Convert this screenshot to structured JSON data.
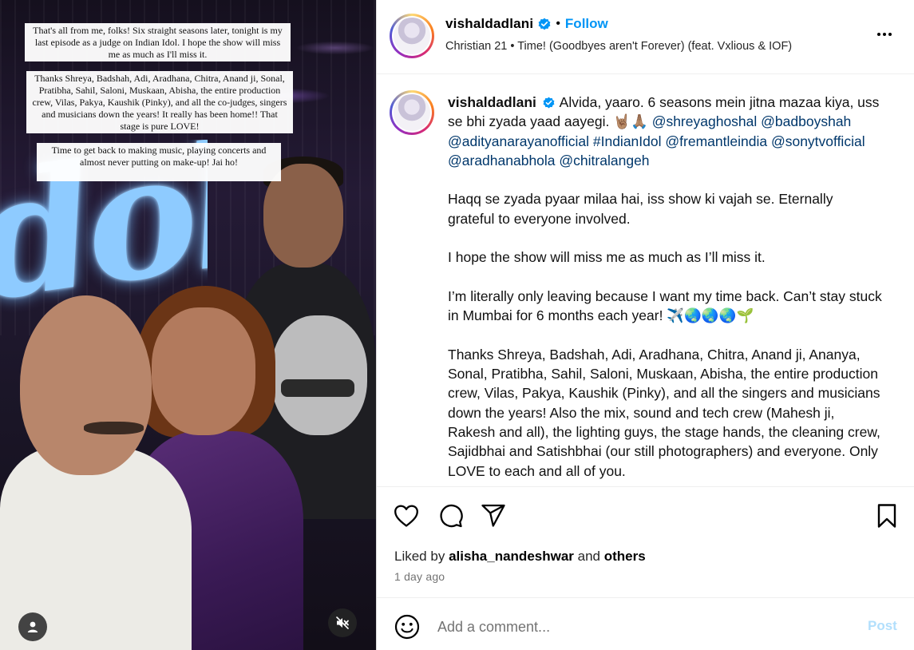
{
  "media": {
    "story_lines": [
      "That's all from me, folks! Six straight seasons later, tonight is my last episode as a judge on Indian Idol. I hope the show will miss me as much as I'll miss it.",
      "Thanks Shreya, Badshah, Adi, Aradhana, Chitra, Anand ji, Sonal, Pratibha, Sahil, Saloni, Muskaan, Abisha, the entire production crew, Vilas, Pakya, Kaushik (Pinky), and all the co-judges, singers and musicians down the years! It really has been home!! That stage is pure LOVE!",
      "Time to get back to making music, playing concerts and almost never putting on make-up! Jai ho!"
    ]
  },
  "header": {
    "username": "vishaldadlani",
    "separator": "•",
    "follow_label": "Follow",
    "song": "Christian 21 • Time! (Goodbyes aren't Forever) (feat. Vxlious & IOF)"
  },
  "caption": {
    "username": "vishaldadlani",
    "intro": "Alvida, yaaro. 6 seasons mein jitna mazaa kiya, uss se bhi zyada yaad aayegi. 🤘🏽🙏🏽",
    "mentions": [
      "@shreyaghoshal",
      "@badboyshah",
      "@adityanarayanofficial",
      "#IndianIdol",
      "@fremantleindia",
      "@sonytvofficial",
      "@aradhanabhola",
      "@chitralangeh"
    ],
    "para2": "Haqq se zyada pyaar milaa hai, iss show ki vajah se. Eternally grateful to everyone involved.",
    "para3": "I hope the show will miss me as much as I’ll miss it.",
    "para4": "I’m literally only leaving because I want my time back. Can’t stay stuck in Mumbai for 6 months each year! ✈️🌏🌏🌏🌱",
    "para5": "Thanks Shreya, Badshah, Adi, Aradhana, Chitra, Anand ji, Ananya, Sonal, Pratibha, Sahil, Saloni, Muskaan, Abisha, the entire production crew, Vilas, Pakya, Kaushik (Pinky), and all the singers and musicians down the years! Also the mix, sound and tech crew (Mahesh ji, Rakesh and all), the lighting guys, the stage hands, the cleaning crew, Sajidbhai and Satishbhai (our still photographers) and everyone. Only LOVE to each and all of you."
  },
  "likes": {
    "prefix": "Liked by",
    "user": "alisha_nandeshwar",
    "and": "and",
    "others": "others"
  },
  "timestamp": "1 day ago",
  "comment": {
    "placeholder": "Add a comment...",
    "post_label": "Post"
  },
  "colors": {
    "link": "#00376b",
    "follow": "#0095f6",
    "verified": "#0095f6",
    "post_disabled": "#b2dffc"
  },
  "icons": [
    "verified-badge-icon",
    "more-options-icon",
    "heart-icon",
    "comment-icon",
    "share-icon",
    "bookmark-icon",
    "emoji-icon",
    "user-tag-icon",
    "muted-speaker-icon"
  ]
}
